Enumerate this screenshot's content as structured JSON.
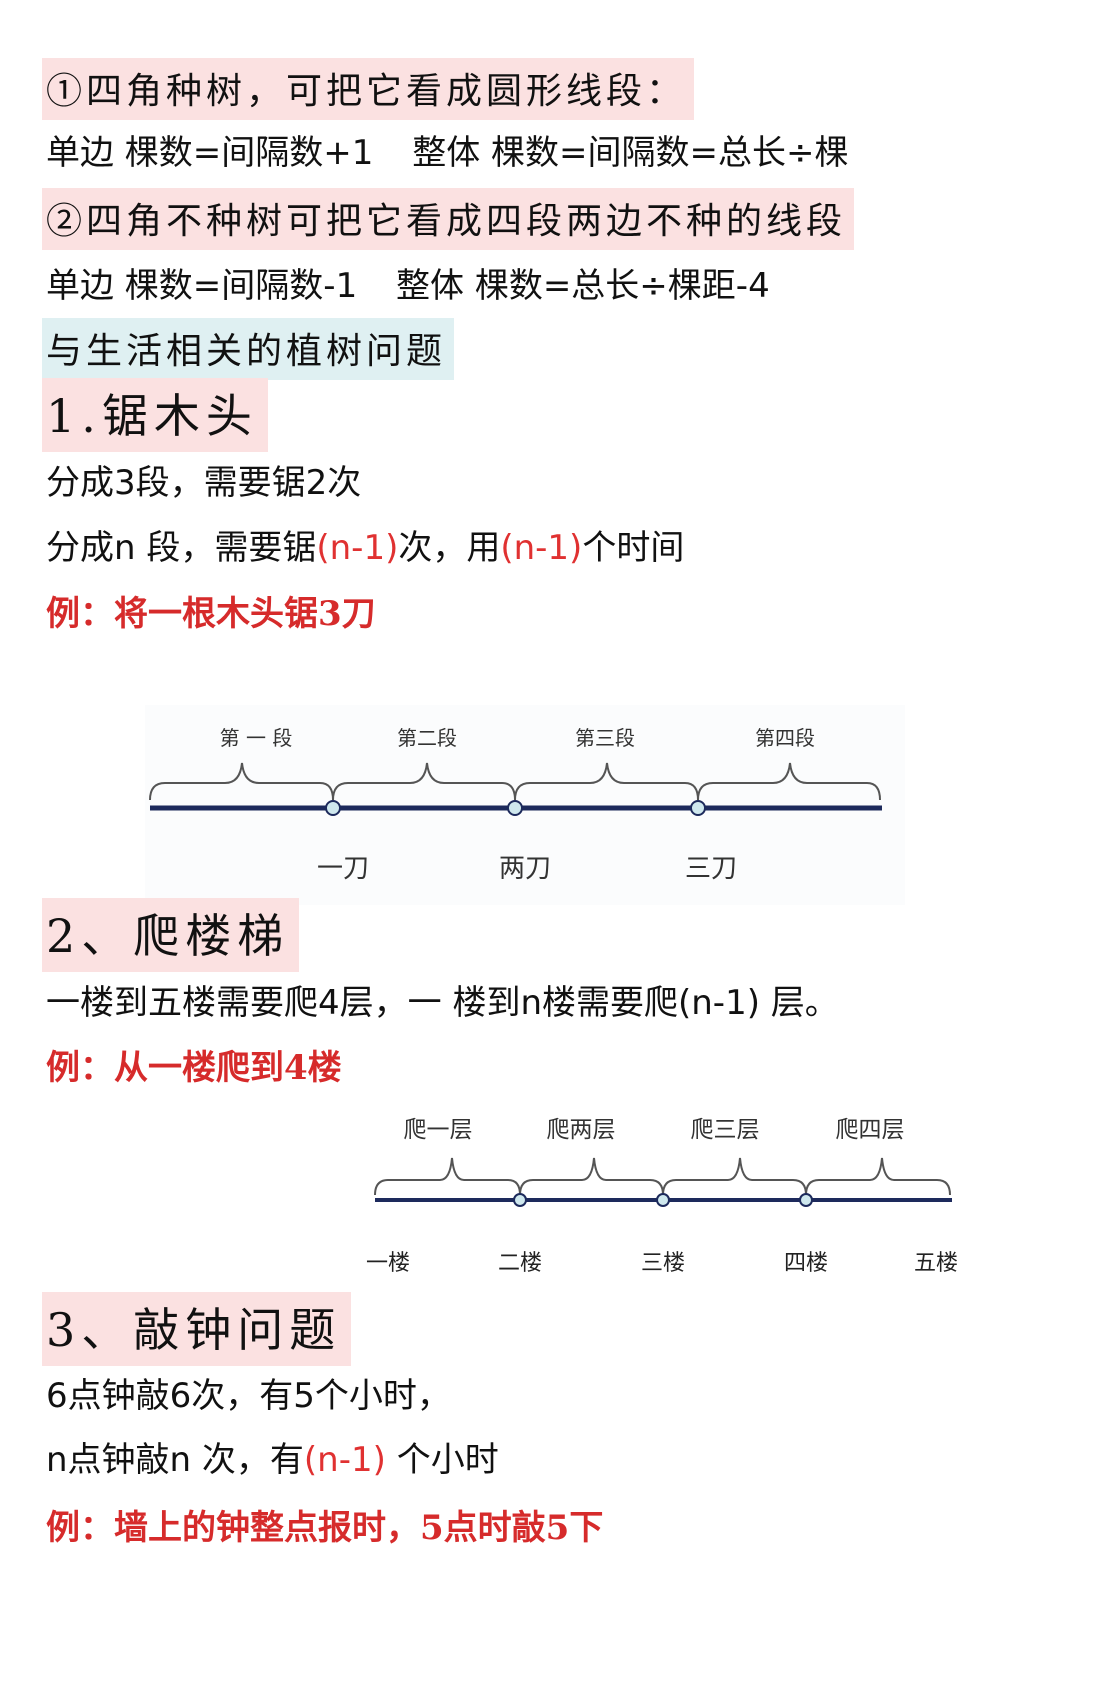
{
  "sections": {
    "rule1": {
      "heading": "①四角种树，可把它看成圆形线段：",
      "formula_a": "单边  棵数=间隔数+1",
      "formula_b": "整体  棵数=间隔数=总长÷棵"
    },
    "rule2": {
      "heading": "②四角不种树可把它看成四段两边不种的线段",
      "formula_a": "单边  棵数=间隔数-1",
      "formula_b": "整体 棵数=总长÷棵距-4"
    },
    "life_title": "与生活相关的植树问题",
    "saw": {
      "title": "1.锯木头",
      "line1": "分成3段，需要锯2次",
      "line2_a": "分成n 段，需要锯",
      "line2_red1": "(n-1)",
      "line2_b": "次，用",
      "line2_red2": "(n-1)",
      "line2_c": "个时间",
      "example": "例：将一根木头锯3刀",
      "diagram": {
        "segments": [
          "第 一 段",
          "第二段",
          "第三段",
          "第四段"
        ],
        "cuts": [
          "一刀",
          "两刀",
          "三刀"
        ]
      }
    },
    "stairs": {
      "title": "2、爬楼梯",
      "line1": "一楼到五楼需要爬4层，一 楼到n楼需要爬(n-1) 层。",
      "example": "例：从一楼爬到4楼",
      "diagram": {
        "segments": [
          "爬一层",
          "爬两层",
          "爬三层",
          "爬四层"
        ],
        "floors": [
          "一楼",
          "二楼",
          "三楼",
          "四楼",
          "五楼"
        ]
      }
    },
    "clock": {
      "title": "3、敲钟问题",
      "line1": "6点钟敲6次，有5个小时，",
      "line2_a": "n点钟敲n 次，有",
      "line2_red": "(n-1)",
      "line2_b": " 个小时",
      "example": "例：墙上的钟整点报时，5点时敲5下"
    }
  },
  "colors": {
    "pink_highlight": "#fbe1e1",
    "blue_highlight": "#dff0f2",
    "red_text": "#d62b2b",
    "line_color": "#1d2a5c",
    "dot_color": "#cfe8ee"
  }
}
